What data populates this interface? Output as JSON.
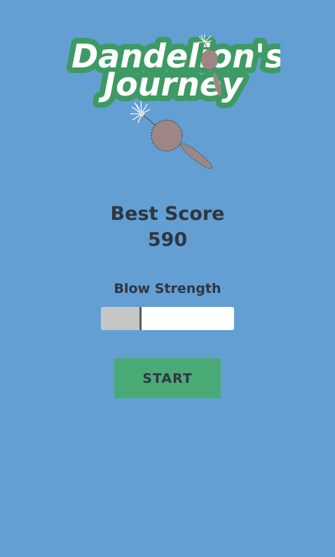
{
  "logo": {
    "line1": "Dandelion's",
    "line2": "Journey"
  },
  "best_score": {
    "label": "Best Score",
    "value": "590"
  },
  "blow_strength": {
    "label": "Blow Strength",
    "level": 0.3
  },
  "start_button": {
    "label": "START"
  },
  "colors": {
    "background": "#639fd3",
    "logo_outline": "#3d9a62",
    "text": "#2f3640",
    "button": "#4aaa76",
    "seed": "#9e8685"
  }
}
